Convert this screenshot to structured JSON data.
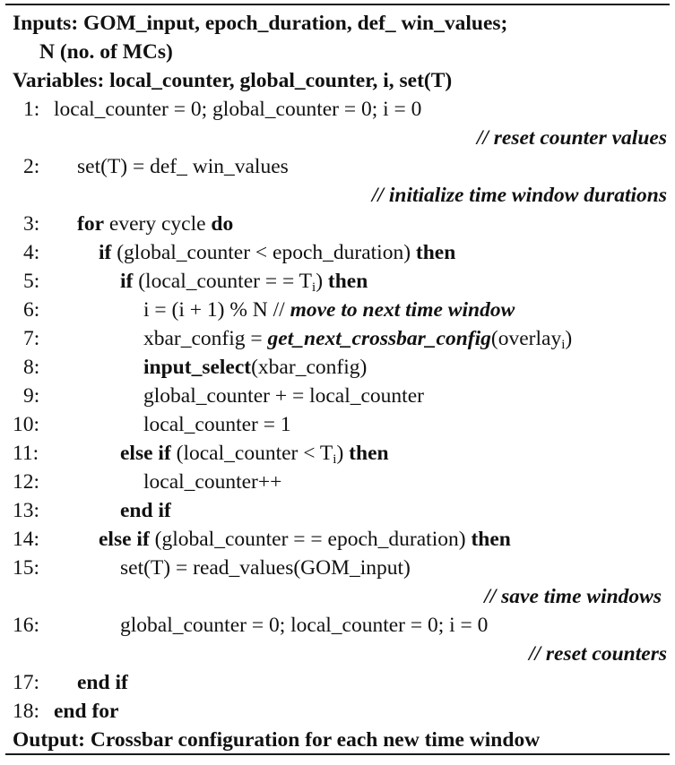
{
  "header": {
    "inputs_label": "Inputs:",
    "inputs_value": "GOM_input, epoch_duration, def_ win_values;",
    "inputs_cont": "N (no. of MCs)",
    "variables_label": "Variables:",
    "variables_value": "local_counter, global_counter, i, set(T)"
  },
  "lines": {
    "l1": {
      "num": "1:",
      "text": "local_counter = 0; global_counter = 0; i = 0",
      "comment": "// reset counter values"
    },
    "l2": {
      "num": "2:",
      "text": "set(T) = def_ win_values",
      "comment": "// initialize time window durations"
    },
    "l3": {
      "num": "3:",
      "kw1": "for",
      "text": " every cycle ",
      "kw2": "do"
    },
    "l4": {
      "num": "4:",
      "kw1": "if",
      "text": " (global_counter < epoch_duration) ",
      "kw2": "then"
    },
    "l5": {
      "num": "5:",
      "kw1": "if",
      "text": " (local_counter = = T",
      "sub": "i",
      "text2": ") ",
      "kw2": "then"
    },
    "l6": {
      "num": "6:",
      "text": "i = (i + 1) % N // ",
      "comment": "move to next time window"
    },
    "l7": {
      "num": "7:",
      "text": "xbar_config = ",
      "fn": "get_next_crossbar_config",
      "text2": "(overlay",
      "sub": "i",
      "text3": ")"
    },
    "l8": {
      "num": "8:",
      "fn": "input_select",
      "text": "(xbar_config)"
    },
    "l9": {
      "num": "9:",
      "text": "global_counter + = local_counter"
    },
    "l10": {
      "num": "10:",
      "text": "local_counter = 1"
    },
    "l11": {
      "num": "11:",
      "kw1": "else if",
      "text": " (local_counter < T",
      "sub": "i",
      "text2": ") ",
      "kw2": "then"
    },
    "l12": {
      "num": "12:",
      "text": "local_counter++"
    },
    "l13": {
      "num": "13:",
      "kw1": "end if"
    },
    "l14": {
      "num": "14:",
      "kw1": "else if",
      "text": " (global_counter = = epoch_duration) ",
      "kw2": "then"
    },
    "l15": {
      "num": "15:",
      "text": "set(T) = read_values(GOM_input)",
      "comment": "// save time windows"
    },
    "l16": {
      "num": "16:",
      "text": "global_counter = 0; local_counter = 0; i = 0",
      "comment": "// reset counters"
    },
    "l17": {
      "num": "17:",
      "kw1": "end if"
    },
    "l18": {
      "num": "18:",
      "kw1": "end for"
    }
  },
  "footer": {
    "output_label": "Output:",
    "output_value": "Crossbar configuration for each new time window"
  }
}
